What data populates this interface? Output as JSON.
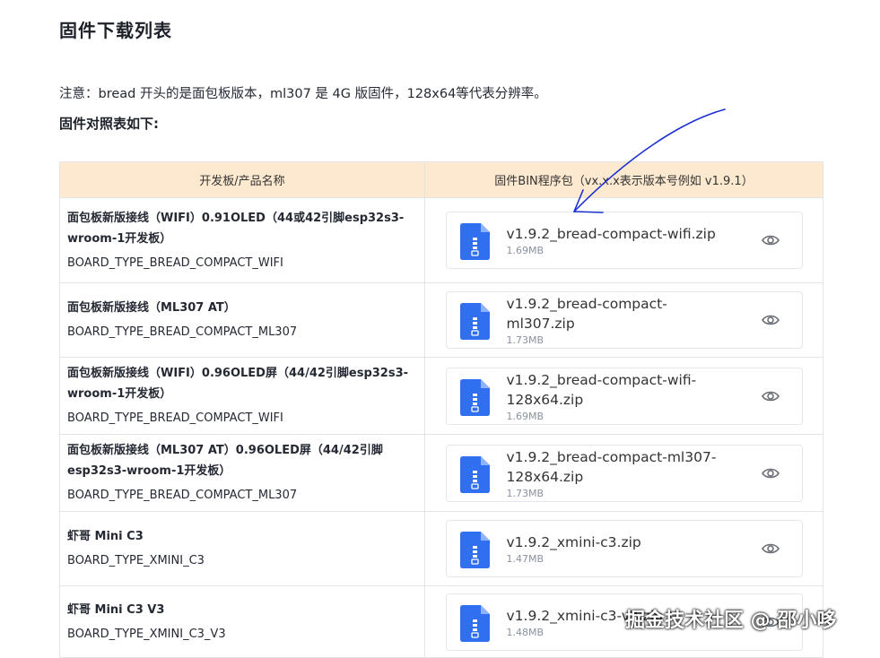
{
  "page": {
    "title": "固件下载列表",
    "note": "注意：bread 开头的是面包板版本，ml307 是 4G 版固件，128x64等代表分辨率。",
    "subtitle": "固件对照表如下:"
  },
  "table": {
    "headers": [
      "开发板/产品名称",
      "固件BIN程序包（vx.x.x表示版本号例如 v1.9.1）"
    ],
    "rows": [
      {
        "name": "面包板新版接线（WIFI）0.91OLED（44或42引脚esp32s3-wroom-1开发板）",
        "board_type": "BOARD_TYPE_BREAD_COMPACT_WIFI",
        "file_name": "v1.9.2_bread-compact-wifi.zip",
        "file_size": "1.69MB"
      },
      {
        "name": "面包板新版接线（ML307 AT）",
        "board_type": "BOARD_TYPE_BREAD_COMPACT_ML307",
        "file_name": "v1.9.2_bread-compact-ml307.zip",
        "file_size": "1.73MB"
      },
      {
        "name": "面包板新版接线（WIFI）0.96OLED屏（44/42引脚esp32s3-wroom-1开发板）",
        "board_type": "BOARD_TYPE_BREAD_COMPACT_WIFI",
        "file_name": "v1.9.2_bread-compact-wifi-128x64.zip",
        "file_size": "1.69MB"
      },
      {
        "name": "面包板新版接线（ML307 AT）0.96OLED屏（44/42引脚esp32s3-wroom-1开发板）",
        "board_type": "BOARD_TYPE_BREAD_COMPACT_ML307",
        "file_name": "v1.9.2_bread-compact-ml307-128x64.zip",
        "file_size": "1.73MB"
      },
      {
        "name": "虾哥 Mini C3",
        "board_type": "BOARD_TYPE_XMINI_C3",
        "file_name": "v1.9.2_xmini-c3.zip",
        "file_size": "1.47MB"
      },
      {
        "name": "虾哥 Mini C3 V3",
        "board_type": "BOARD_TYPE_XMINI_C3_V3",
        "file_name": "v1.9.2_xmini-c3-v3.zip",
        "file_size": "1.48MB"
      }
    ]
  },
  "watermark": "掘金技术社区 @ 邵小哆",
  "colors": {
    "header_bg": "#fde9cf",
    "zip_icon": "#2f6ff0",
    "annotation_arrow": "#1a2fd0"
  },
  "icons": {
    "file": "zip-file-icon",
    "preview": "eye-icon"
  }
}
